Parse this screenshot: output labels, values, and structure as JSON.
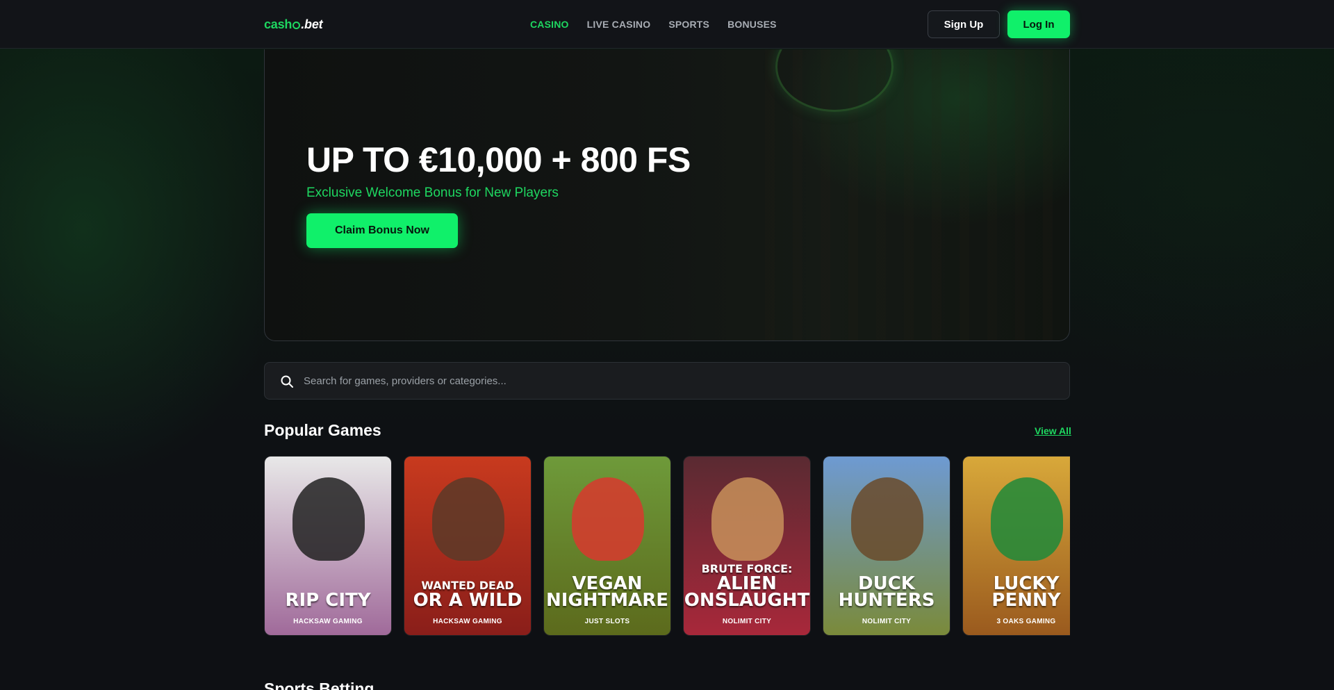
{
  "header": {
    "logo_part1": "cash",
    "logo_part2": ".bet",
    "nav": [
      {
        "label": "CASINO",
        "active": true
      },
      {
        "label": "LIVE CASINO",
        "active": false
      },
      {
        "label": "SPORTS",
        "active": false
      },
      {
        "label": "BONUSES",
        "active": false
      }
    ],
    "signup_label": "Sign Up",
    "login_label": "Log In"
  },
  "hero": {
    "title": "UP TO €10,000 + 800 FS",
    "subtitle": "Exclusive Welcome Bonus for New Players",
    "cta_label": "Claim Bonus Now"
  },
  "search": {
    "placeholder": "Search for games, providers or categories..."
  },
  "popular": {
    "title": "Popular Games",
    "view_all": "View All",
    "games": [
      {
        "pre": "",
        "name": "RIP CITY",
        "provider": "HACKSAW GAMING",
        "bg_top": "#e8e8e8",
        "bg_bottom": "#a06a9a",
        "figure": "#222222"
      },
      {
        "pre": "WANTED DEAD",
        "name": "OR A WILD",
        "provider": "HACKSAW GAMING",
        "bg_top": "#c83a1e",
        "bg_bottom": "#8a1e1a",
        "figure": "#5a3a28"
      },
      {
        "pre": "",
        "name": "VEGAN NIGHTMARE",
        "provider": "JUST SLOTS",
        "bg_top": "#6e9a3a",
        "bg_bottom": "#5c6a1c",
        "figure": "#d8382e"
      },
      {
        "pre": "BRUTE FORCE:",
        "name": "ALIEN ONSLAUGHT",
        "provider": "NOLIMIT CITY",
        "bg_top": "#5a2a32",
        "bg_bottom": "#a8283a",
        "figure": "#c8905a"
      },
      {
        "pre": "",
        "name": "DUCK HUNTERS",
        "provider": "NOLIMIT CITY",
        "bg_top": "#6e9ad2",
        "bg_bottom": "#7a8a3a",
        "figure": "#6a4a2a"
      },
      {
        "pre": "",
        "name": "LUCKY PENNY",
        "provider": "3 OAKS GAMING",
        "bg_top": "#d8a83a",
        "bg_bottom": "#9a5a1e",
        "figure": "#1e8a3a"
      }
    ]
  },
  "next_section_title": "Sports Betting"
}
